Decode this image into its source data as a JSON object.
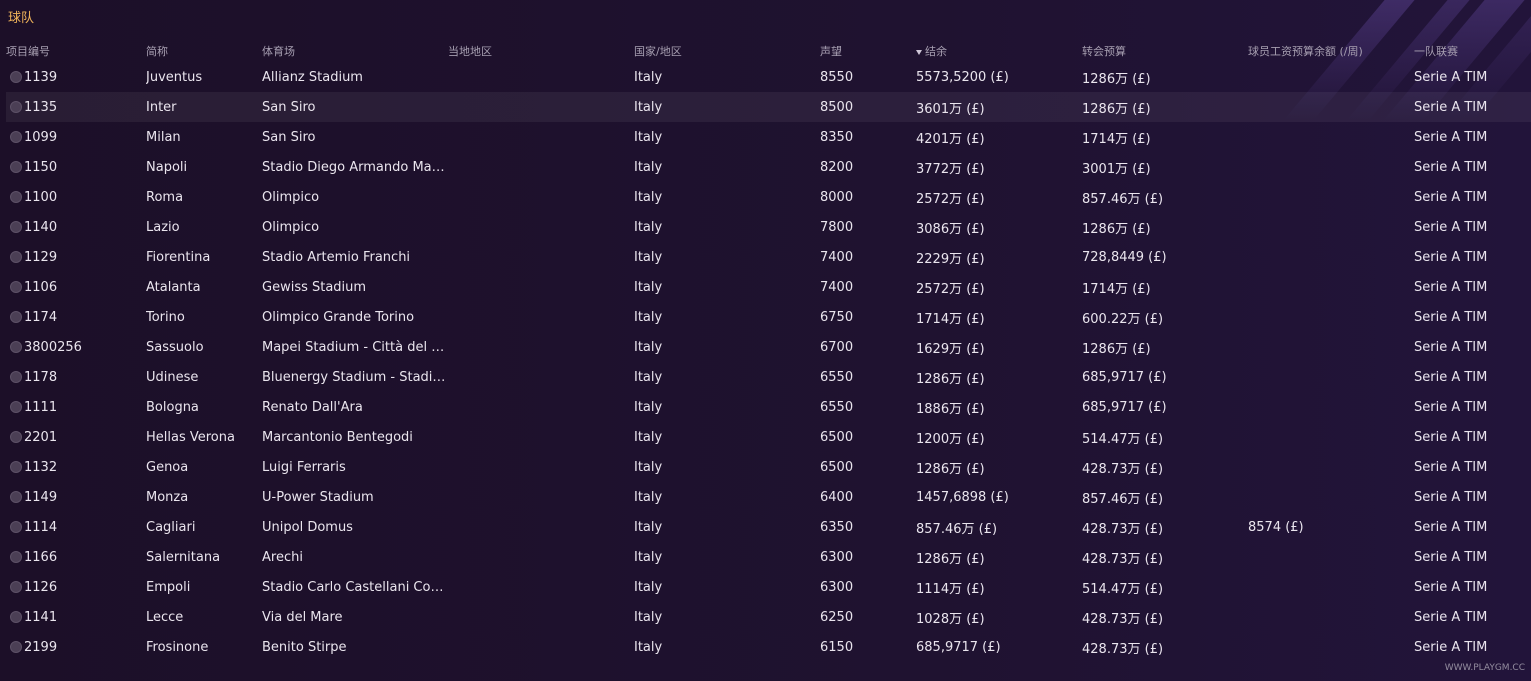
{
  "title": "球队",
  "columns": {
    "id": "项目编号",
    "short_name": "简称",
    "stadium": "体育场",
    "local_region": "当地地区",
    "nation": "国家/地区",
    "reputation": "声望",
    "balance": "结余",
    "transfer_budget": "转会预算",
    "wage_budget": "球员工资预算余额 (/周)",
    "league": "一队联赛"
  },
  "rows": [
    {
      "id": "1139",
      "name": "Juventus",
      "stadium": "Allianz Stadium",
      "region": "",
      "nation": "Italy",
      "rep": "8550",
      "balance": "5573,5200 (£)",
      "transfer": "1286万 (£)",
      "wage": "",
      "league": "Serie A TIM"
    },
    {
      "id": "1135",
      "name": "Inter",
      "stadium": "San Siro",
      "region": "",
      "nation": "Italy",
      "rep": "8500",
      "balance": "3601万 (£)",
      "transfer": "1286万 (£)",
      "wage": "",
      "league": "Serie A TIM"
    },
    {
      "id": "1099",
      "name": "Milan",
      "stadium": "San Siro",
      "region": "",
      "nation": "Italy",
      "rep": "8350",
      "balance": "4201万 (£)",
      "transfer": "1714万 (£)",
      "wage": "",
      "league": "Serie A TIM"
    },
    {
      "id": "1150",
      "name": "Napoli",
      "stadium": "Stadio Diego Armando Marad...",
      "region": "",
      "nation": "Italy",
      "rep": "8200",
      "balance": "3772万 (£)",
      "transfer": "3001万 (£)",
      "wage": "",
      "league": "Serie A TIM"
    },
    {
      "id": "1100",
      "name": "Roma",
      "stadium": "Olimpico",
      "region": "",
      "nation": "Italy",
      "rep": "8000",
      "balance": "2572万 (£)",
      "transfer": "857.46万 (£)",
      "wage": "",
      "league": "Serie A TIM"
    },
    {
      "id": "1140",
      "name": "Lazio",
      "stadium": "Olimpico",
      "region": "",
      "nation": "Italy",
      "rep": "7800",
      "balance": "3086万 (£)",
      "transfer": "1286万 (£)",
      "wage": "",
      "league": "Serie A TIM"
    },
    {
      "id": "1129",
      "name": "Fiorentina",
      "stadium": "Stadio Artemio Franchi",
      "region": "",
      "nation": "Italy",
      "rep": "7400",
      "balance": "2229万 (£)",
      "transfer": "728,8449 (£)",
      "wage": "",
      "league": "Serie A TIM"
    },
    {
      "id": "1106",
      "name": "Atalanta",
      "stadium": "Gewiss Stadium",
      "region": "",
      "nation": "Italy",
      "rep": "7400",
      "balance": "2572万 (£)",
      "transfer": "1714万 (£)",
      "wage": "",
      "league": "Serie A TIM"
    },
    {
      "id": "1174",
      "name": "Torino",
      "stadium": "Olimpico Grande Torino",
      "region": "",
      "nation": "Italy",
      "rep": "6750",
      "balance": "1714万 (£)",
      "transfer": "600.22万 (£)",
      "wage": "",
      "league": "Serie A TIM"
    },
    {
      "id": "3800256",
      "name": "Sassuolo",
      "stadium": "Mapei Stadium - Città del Tri...",
      "region": "",
      "nation": "Italy",
      "rep": "6700",
      "balance": "1629万 (£)",
      "transfer": "1286万 (£)",
      "wage": "",
      "league": "Serie A TIM"
    },
    {
      "id": "1178",
      "name": "Udinese",
      "stadium": "Bluenergy Stadium - Stadio F...",
      "region": "",
      "nation": "Italy",
      "rep": "6550",
      "balance": "1286万 (£)",
      "transfer": "685,9717 (£)",
      "wage": "",
      "league": "Serie A TIM"
    },
    {
      "id": "1111",
      "name": "Bologna",
      "stadium": "Renato Dall'Ara",
      "region": "",
      "nation": "Italy",
      "rep": "6550",
      "balance": "1886万 (£)",
      "transfer": "685,9717 (£)",
      "wage": "",
      "league": "Serie A TIM"
    },
    {
      "id": "2201",
      "name": "Hellas Verona",
      "stadium": "Marcantonio Bentegodi",
      "region": "",
      "nation": "Italy",
      "rep": "6500",
      "balance": "1200万 (£)",
      "transfer": "514.47万 (£)",
      "wage": "",
      "league": "Serie A TIM"
    },
    {
      "id": "1132",
      "name": "Genoa",
      "stadium": "Luigi Ferraris",
      "region": "",
      "nation": "Italy",
      "rep": "6500",
      "balance": "1286万 (£)",
      "transfer": "428.73万 (£)",
      "wage": "",
      "league": "Serie A TIM"
    },
    {
      "id": "1149",
      "name": "Monza",
      "stadium": "U-Power Stadium",
      "region": "",
      "nation": "Italy",
      "rep": "6400",
      "balance": "1457,6898 (£)",
      "transfer": "857.46万 (£)",
      "wage": "",
      "league": "Serie A TIM"
    },
    {
      "id": "1114",
      "name": "Cagliari",
      "stadium": "Unipol Domus",
      "region": "",
      "nation": "Italy",
      "rep": "6350",
      "balance": "857.46万 (£)",
      "transfer": "428.73万 (£)",
      "wage": "8574 (£)",
      "league": "Serie A TIM"
    },
    {
      "id": "1166",
      "name": "Salernitana",
      "stadium": "Arechi",
      "region": "",
      "nation": "Italy",
      "rep": "6300",
      "balance": "1286万 (£)",
      "transfer": "428.73万 (£)",
      "wage": "",
      "league": "Serie A TIM"
    },
    {
      "id": "1126",
      "name": "Empoli",
      "stadium": "Stadio Carlo Castellani Comp...",
      "region": "",
      "nation": "Italy",
      "rep": "6300",
      "balance": "1114万 (£)",
      "transfer": "514.47万 (£)",
      "wage": "",
      "league": "Serie A TIM"
    },
    {
      "id": "1141",
      "name": "Lecce",
      "stadium": "Via del Mare",
      "region": "",
      "nation": "Italy",
      "rep": "6250",
      "balance": "1028万 (£)",
      "transfer": "428.73万 (£)",
      "wage": "",
      "league": "Serie A TIM"
    },
    {
      "id": "2199",
      "name": "Frosinone",
      "stadium": "Benito Stirpe",
      "region": "",
      "nation": "Italy",
      "rep": "6150",
      "balance": "685,9717 (£)",
      "transfer": "428.73万 (£)",
      "wage": "",
      "league": "Serie A TIM"
    }
  ],
  "watermark": "WWW.PLAYGM.CC"
}
